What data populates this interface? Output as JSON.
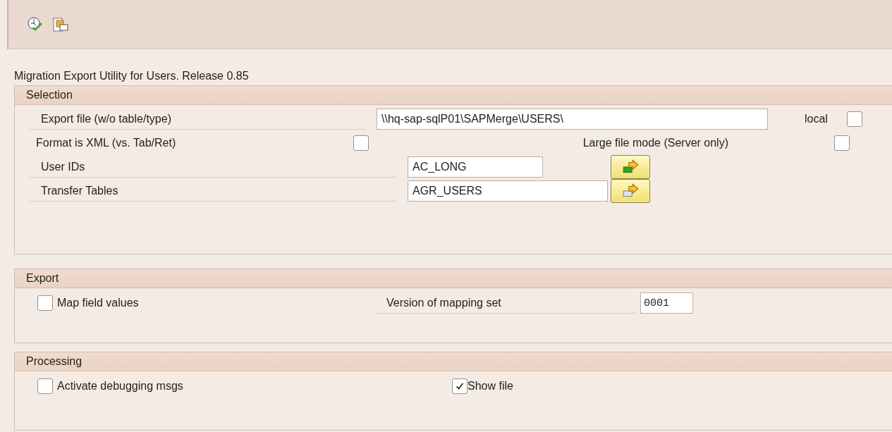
{
  "title": "Migration Export Utility for Users.  Release 0.85",
  "selection": {
    "title": "Selection",
    "export_file": {
      "label": "Export file (w/o table/type)",
      "value": "\\\\hq-sap-sqlP01\\SAPMerge\\USERS\\"
    },
    "local": {
      "label": "local",
      "checked": false
    },
    "format_xml": {
      "label": "Format is XML (vs. Tab/Ret)",
      "checked": false
    },
    "large_file": {
      "label": "Large file mode (Server only)",
      "checked": false
    },
    "user_ids": {
      "label": "User IDs",
      "value": "AC_LONG"
    },
    "transfer_tables": {
      "label": "Transfer Tables",
      "value": "AGR_USERS"
    }
  },
  "export": {
    "title": "Export",
    "map_field_values": {
      "label": "Map field values",
      "checked": false
    },
    "mapping_version": {
      "label": "Version of mapping set",
      "value": "0001"
    }
  },
  "processing": {
    "title": "Processing",
    "debugging": {
      "label": "Activate debugging msgs",
      "checked": false
    },
    "show_file": {
      "label": "Show file",
      "checked": true
    }
  }
}
